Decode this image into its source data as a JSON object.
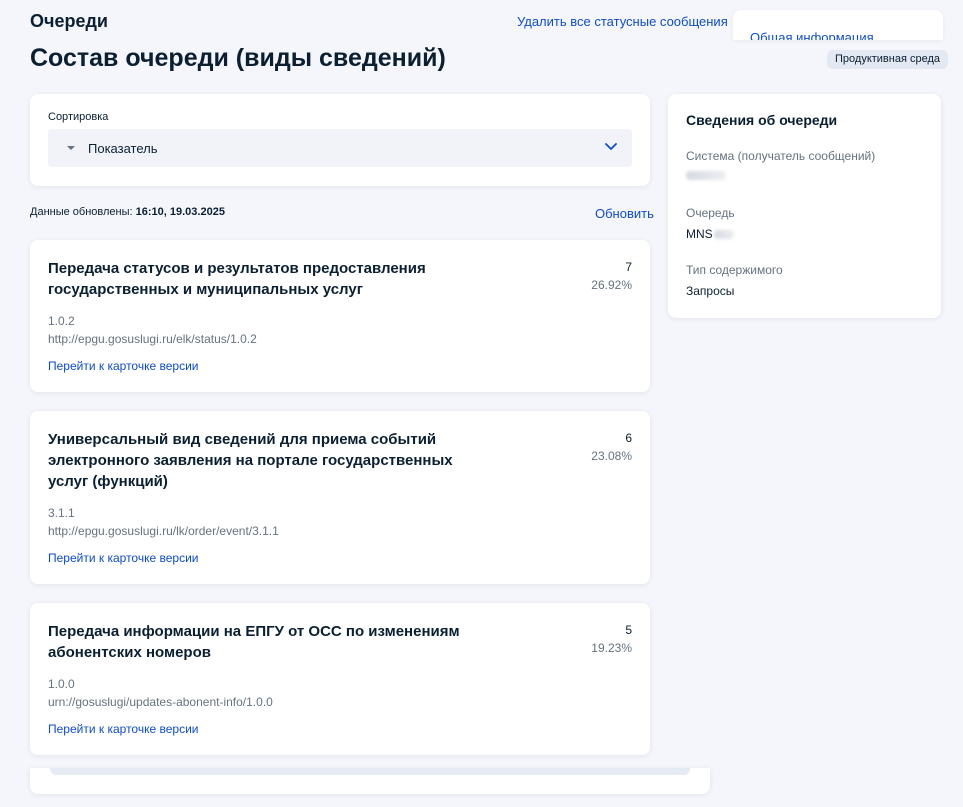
{
  "header": {
    "title": "Очереди",
    "delete_link": "Удалить все статусные сообщения",
    "tab_label": "Общая информация"
  },
  "page": {
    "title": "Состав очереди (виды сведений)",
    "env_badge": "Продуктивная среда"
  },
  "sort": {
    "label": "Сортировка",
    "value": "Показатель"
  },
  "updated": {
    "label": "Данные обновлены:",
    "value": "16:10, 19.03.2025",
    "refresh": "Обновить"
  },
  "items": [
    {
      "title": "Передача статусов и результатов предоставления государственных и муниципальных услуг",
      "count": "7",
      "percent": "26.92%",
      "version": "1.0.2",
      "uri": "http://epgu.gosuslugi.ru/elk/status/1.0.2",
      "link": "Перейти к карточке версии"
    },
    {
      "title": "Универсальный вид сведений для приема событий электронного заявления на портале государственных услуг (функций)",
      "count": "6",
      "percent": "23.08%",
      "version": "3.1.1",
      "uri": "http://epgu.gosuslugi.ru/lk/order/event/3.1.1",
      "link": "Перейти к карточке версии"
    },
    {
      "title": "Передача информации на ЕПГУ от ОСС по изменениям абонентских номеров",
      "count": "5",
      "percent": "19.23%",
      "version": "1.0.0",
      "uri": "urn://gosuslugi/updates-abonent-info/1.0.0",
      "link": "Перейти к карточке версии"
    }
  ],
  "info": {
    "title": "Сведения об очереди",
    "system_label": "Система (получатель сообщений)",
    "queue_label": "Очередь",
    "queue_value": "MNS",
    "content_type_label": "Тип содержимого",
    "content_type_value": "Запросы"
  },
  "colors": {
    "accent": "#0d4cd3",
    "text": "#0b1f33",
    "muted": "#66727f",
    "background": "#f4f6fb"
  }
}
